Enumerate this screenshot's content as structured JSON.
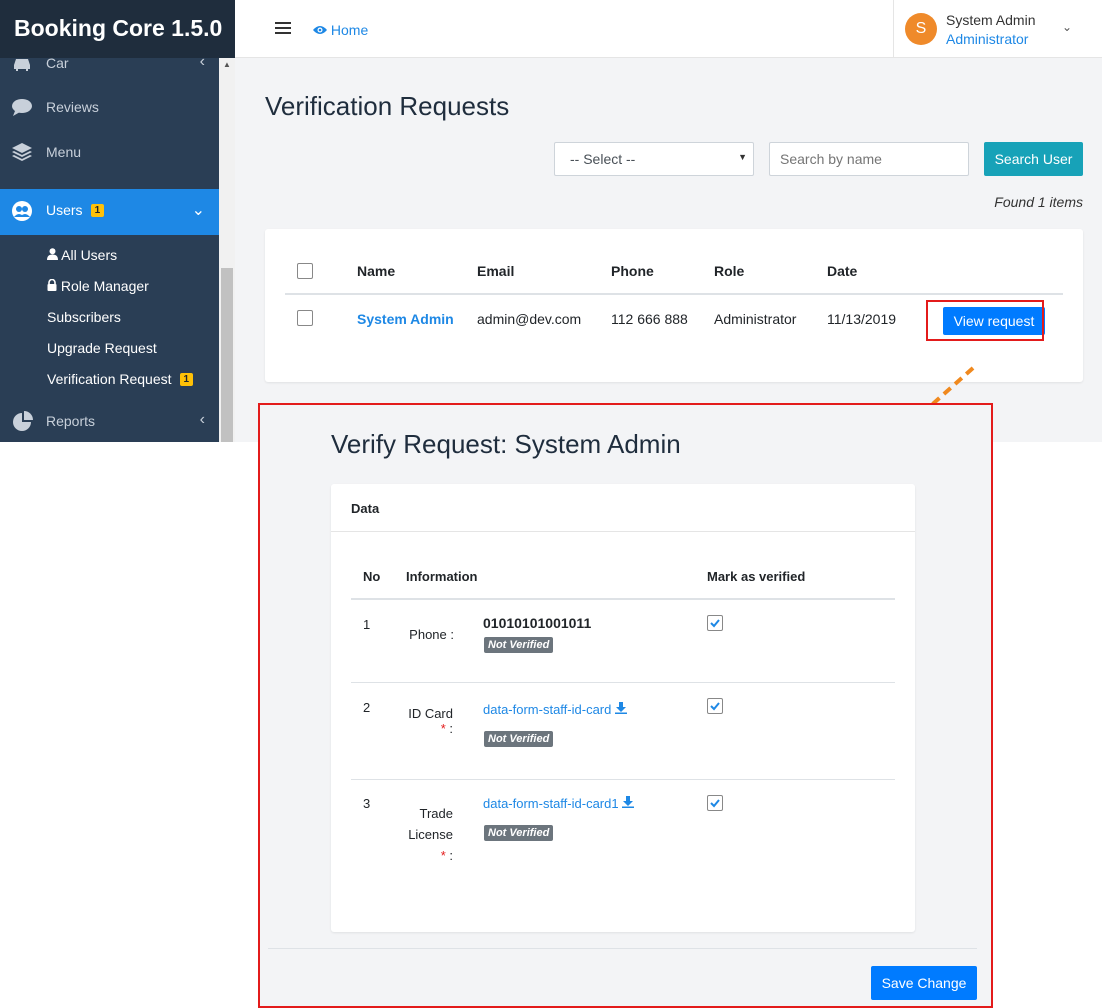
{
  "brand": "Booking Core 1.5.0",
  "sidebar": {
    "items": [
      {
        "label": "Car",
        "icon": "car-icon"
      },
      {
        "label": "Reviews",
        "icon": "comment-icon"
      },
      {
        "label": "Menu",
        "icon": "layers-icon"
      },
      {
        "label": "Users",
        "icon": "users-icon",
        "badge": "1"
      },
      {
        "label": "Reports",
        "icon": "pie-chart-icon"
      }
    ],
    "users_submenu": [
      {
        "label": "All Users",
        "icon": "user-icon"
      },
      {
        "label": "Role Manager",
        "icon": "lock-icon"
      },
      {
        "label": "Subscribers"
      },
      {
        "label": "Upgrade Request"
      },
      {
        "label": "Verification Request",
        "badge": "1"
      }
    ]
  },
  "topbar": {
    "home_label": "Home",
    "user_name": "System Admin",
    "user_role": "Administrator",
    "avatar_letter": "S"
  },
  "page": {
    "title": "Verification Requests",
    "select_value": "-- Select --",
    "search_placeholder": "Search by name",
    "search_button": "Search User",
    "found_text": "Found 1 items"
  },
  "users_table": {
    "headers": [
      "Name",
      "Email",
      "Phone",
      "Role",
      "Date"
    ],
    "rows": [
      {
        "name": "System Admin",
        "email": "admin@dev.com",
        "phone": "112 666 888",
        "role": "Administrator",
        "date": "11/13/2019",
        "action": "View request"
      }
    ]
  },
  "verify": {
    "title": "Verify Request: System Admin",
    "card_title": "Data",
    "headers": {
      "no": "No",
      "information": "Information",
      "mark": "Mark as verified"
    },
    "rows": [
      {
        "no": "1",
        "label": "Phone :",
        "value": "01010101001011",
        "status": "Not Verified",
        "checked": true
      },
      {
        "no": "2",
        "label_line1": "ID Card",
        "required": "*",
        "label_colon": ":",
        "value": "data-form-staff-id-card",
        "status": "Not Verified",
        "checked": true
      },
      {
        "no": "3",
        "label_line1": "Trade",
        "label_line2": "License",
        "required": "*",
        "label_colon": ":",
        "value": "data-form-staff-id-card1",
        "status": "Not Verified",
        "checked": true
      }
    ],
    "save_button": "Save Change"
  },
  "colors": {
    "sidebar_bg": "#2a3e55",
    "brand_bg": "#1f2d3d",
    "active_nav": "#1e88e5",
    "primary": "#007bff",
    "info": "#17a2b8",
    "highlight_border": "#e31b1b",
    "arrow": "#f0891e",
    "badge_yellow": "#ffc107",
    "status_grey": "#6c757d"
  }
}
